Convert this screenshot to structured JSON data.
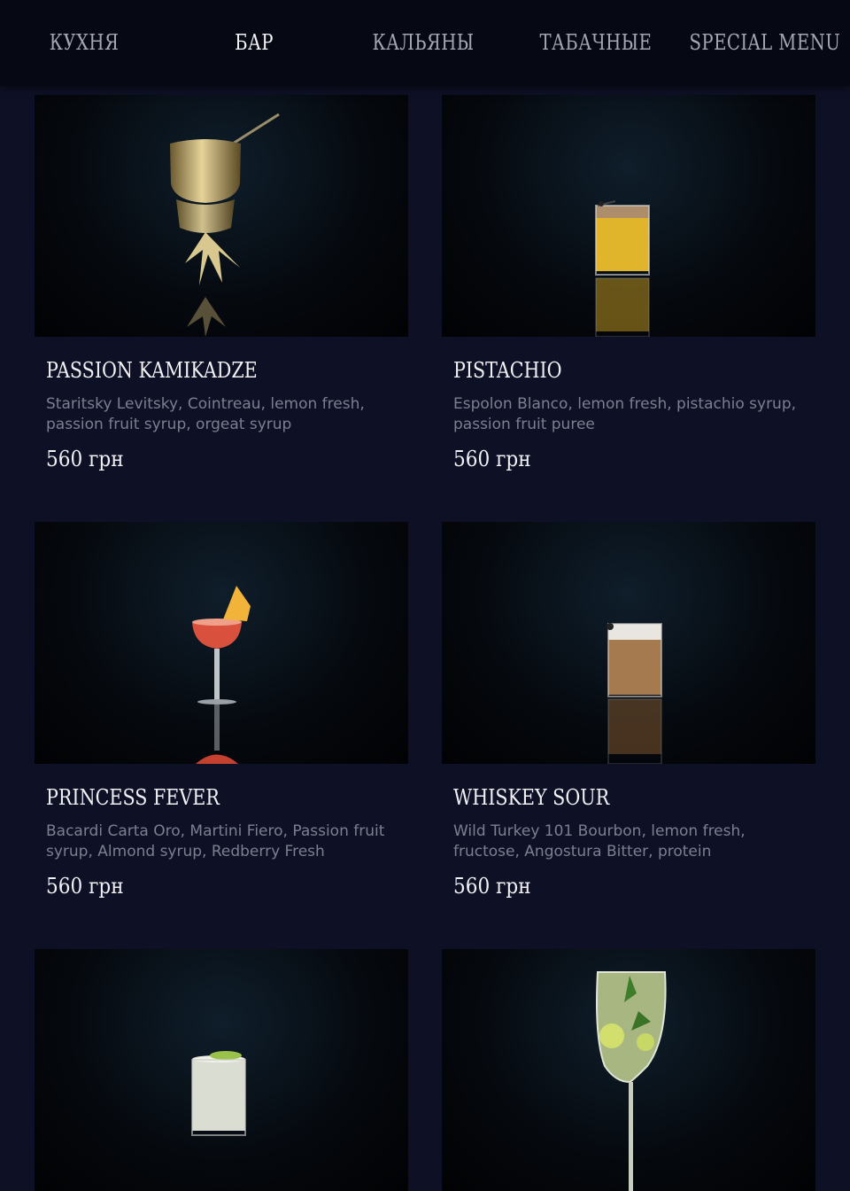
{
  "nav": {
    "tabs": [
      {
        "label": "КУХНЯ",
        "active": false
      },
      {
        "label": "БАР",
        "active": true
      },
      {
        "label": "КАЛЬЯНЫ",
        "active": false
      },
      {
        "label": "ТАБАЧНЫЕ",
        "active": false
      },
      {
        "label": "SPECIAL MENU",
        "active": false
      }
    ]
  },
  "items": [
    {
      "name": "PASSION KAMIKADZE",
      "description": "Staritsky Levitsky, Cointreau, lemon fresh, passion fruit syrup, orgeat syrup",
      "price": "560 грн",
      "photo": "pineapple-gold-cup"
    },
    {
      "name": "PISTACHIO",
      "description": "Espolon Blanco, lemon fresh, pistachio syrup, passion fruit puree",
      "price": "560 грн",
      "photo": "yellow-rocks-glass"
    },
    {
      "name": "PRINCESS FEVER",
      "description": "Bacardi Carta Oro, Martini Fiero, Passion fruit syrup,  Almond syrup, Redberry Fresh",
      "price": "560 грн",
      "photo": "red-coupe-pineapple"
    },
    {
      "name": "WHISKEY SOUR",
      "description": "Wild Turkey 101 Bourbon, lemon fresh, fructose, Angostura Bitter, protein",
      "price": "560 грн",
      "photo": "amber-rocks-foam"
    },
    {
      "name": "",
      "description": "",
      "price": "",
      "photo": "white-glass-lime"
    },
    {
      "name": "",
      "description": "",
      "price": "",
      "photo": "wine-glass-mojito"
    }
  ]
}
